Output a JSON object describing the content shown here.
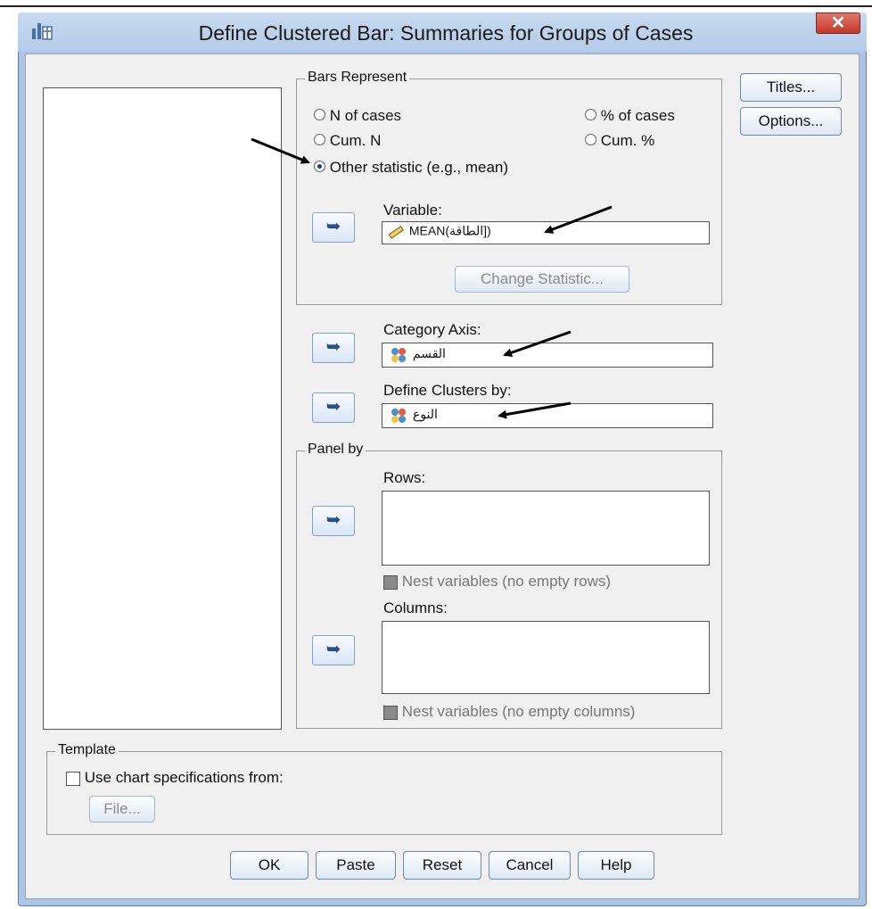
{
  "window": {
    "title": "Define Clustered Bar: Summaries for Groups of Cases",
    "close_label": "✕"
  },
  "bars_represent": {
    "legend": "Bars Represent",
    "options": [
      {
        "label": "N of cases",
        "selected": false
      },
      {
        "label": "% of cases",
        "selected": false
      },
      {
        "label": "Cum. N",
        "selected": false
      },
      {
        "label": "Cum. %",
        "selected": false
      },
      {
        "label": "Other statistic (e.g., mean)",
        "selected": true
      }
    ],
    "variable_label": "Variable:",
    "variable_value": "MEAN(الطاقة])",
    "variable_icon": "ruler-icon",
    "change_statistic_label": "Change Statistic..."
  },
  "category_axis": {
    "label": "Category Axis:",
    "value": "القسم",
    "icon": "nominal-variable-icon"
  },
  "define_clusters": {
    "label": "Define Clusters by:",
    "value": "النوع",
    "icon": "nominal-variable-icon"
  },
  "panel_by": {
    "legend": "Panel by",
    "rows_label": "Rows:",
    "nest_rows_label": "Nest variables (no empty rows)",
    "columns_label": "Columns:",
    "nest_columns_label": "Nest variables (no empty columns)"
  },
  "template": {
    "legend": "Template",
    "use_spec_label": "Use chart specifications from:",
    "file_label": "File..."
  },
  "side_buttons": {
    "titles_label": "Titles...",
    "options_label": "Options..."
  },
  "bottom_buttons": {
    "ok": "OK",
    "paste": "Paste",
    "reset": "Reset",
    "cancel": "Cancel",
    "help": "Help"
  },
  "arrow_glyph": "➥",
  "colors": {
    "title_bar": "#b4cbe9",
    "close_button": "#c1392b",
    "dialog_bg": "#f0f0f0"
  }
}
